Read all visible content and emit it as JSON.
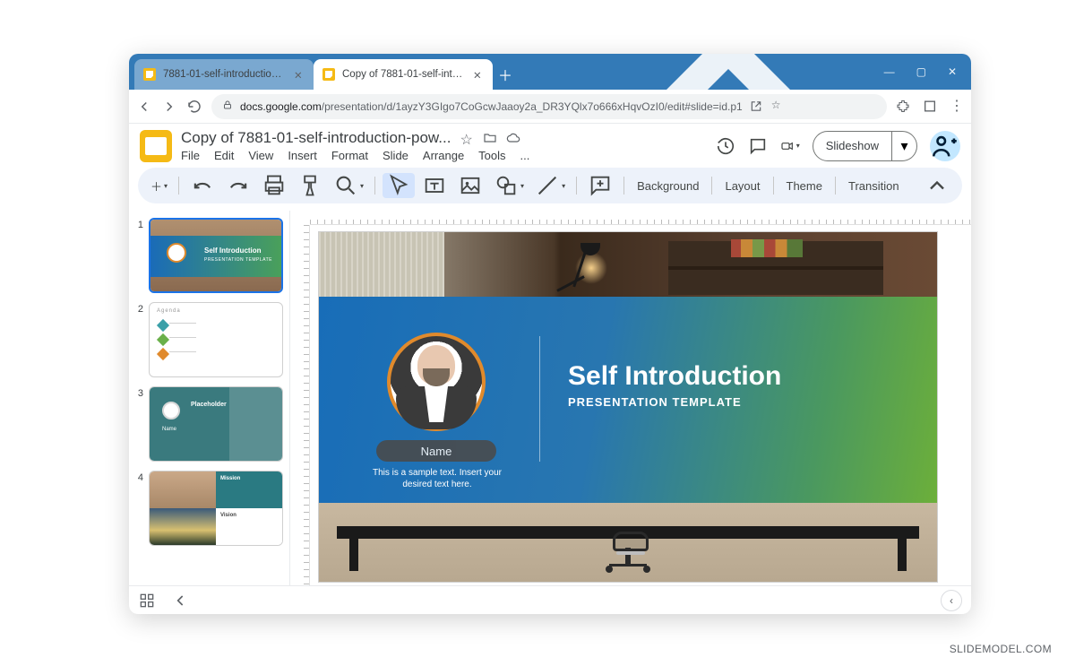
{
  "browser": {
    "tabs": [
      {
        "title": "7881-01-self-introduction-powe",
        "active": false
      },
      {
        "title": "Copy of 7881-01-self-introductio",
        "active": true
      }
    ],
    "url_host": "docs.google.com",
    "url_path": "/presentation/d/1ayzY3GIgo7CoGcwJaaoy2a_DR3YQlx7o666xHqvOzI0/edit#slide=id.p1"
  },
  "app": {
    "doc_title": "Copy of 7881-01-self-introduction-pow...",
    "menus": [
      "File",
      "Edit",
      "View",
      "Insert",
      "Format",
      "Slide",
      "Arrange",
      "Tools",
      "..."
    ],
    "slideshow_label": "Slideshow",
    "toolbar_text": {
      "background": "Background",
      "layout": "Layout",
      "theme": "Theme",
      "transition": "Transition"
    }
  },
  "filmstrip": {
    "slides": [
      {
        "num": "1",
        "selected": true,
        "title": "Self Introduction",
        "sub": "PRESENTATION TEMPLATE"
      },
      {
        "num": "2",
        "selected": false,
        "header": "Agenda"
      },
      {
        "num": "3",
        "selected": false,
        "label": "Placeholder",
        "name": "Name"
      },
      {
        "num": "4",
        "selected": false,
        "mission": "Mission",
        "vision": "Vision"
      }
    ]
  },
  "slide": {
    "name_label": "Name",
    "sample_text": "This is a sample text. Insert your desired text here.",
    "title": "Self Introduction",
    "subtitle": "PRESENTATION TEMPLATE"
  },
  "watermark": "SLIDEMODEL.COM"
}
